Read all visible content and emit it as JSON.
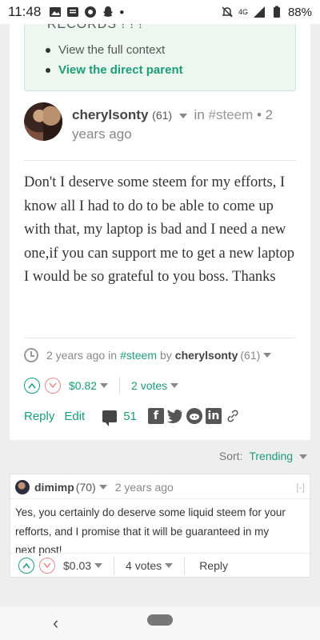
{
  "status_bar": {
    "time": "11:48",
    "battery": "88%",
    "network": "4G"
  },
  "context": {
    "records_text": "RECORDS ! ! !",
    "links": [
      "View the full context",
      "View the direct parent"
    ]
  },
  "post": {
    "author": "cherylsonty",
    "reputation": "(61)",
    "in_label": "in",
    "tag": "#steem",
    "age": "• 2 years ago",
    "body": "Don't I deserve some steem for my efforts, I know all I had to do to be able to come up with that, my laptop is bad and I need a new one,if you can support me to get a new laptop I would be so grateful to you boss. Thanks",
    "meta_age": "2 years ago",
    "meta_in": "in",
    "meta_tag": "#steem",
    "meta_by": "by",
    "meta_author": "cherylsonty",
    "meta_rep": "(61)",
    "payout": "$0.82",
    "votes": "2 votes",
    "reply_label": "Reply",
    "edit_label": "Edit",
    "comment_count": "51"
  },
  "sort": {
    "label": "Sort:",
    "value": "Trending"
  },
  "reply": {
    "author": "dimimp",
    "reputation": "(70)",
    "age": "2 years ago",
    "collapse": "[-]",
    "body": "Yes, you certainly do deserve some liquid steem for your refforts, and I promise that it will be guaranteed in my next post!",
    "payout": "$0.03",
    "votes": "4 votes",
    "reply_label": "Reply"
  },
  "colors": {
    "accent": "#1a9e77",
    "downvote": "#e58a8a"
  }
}
